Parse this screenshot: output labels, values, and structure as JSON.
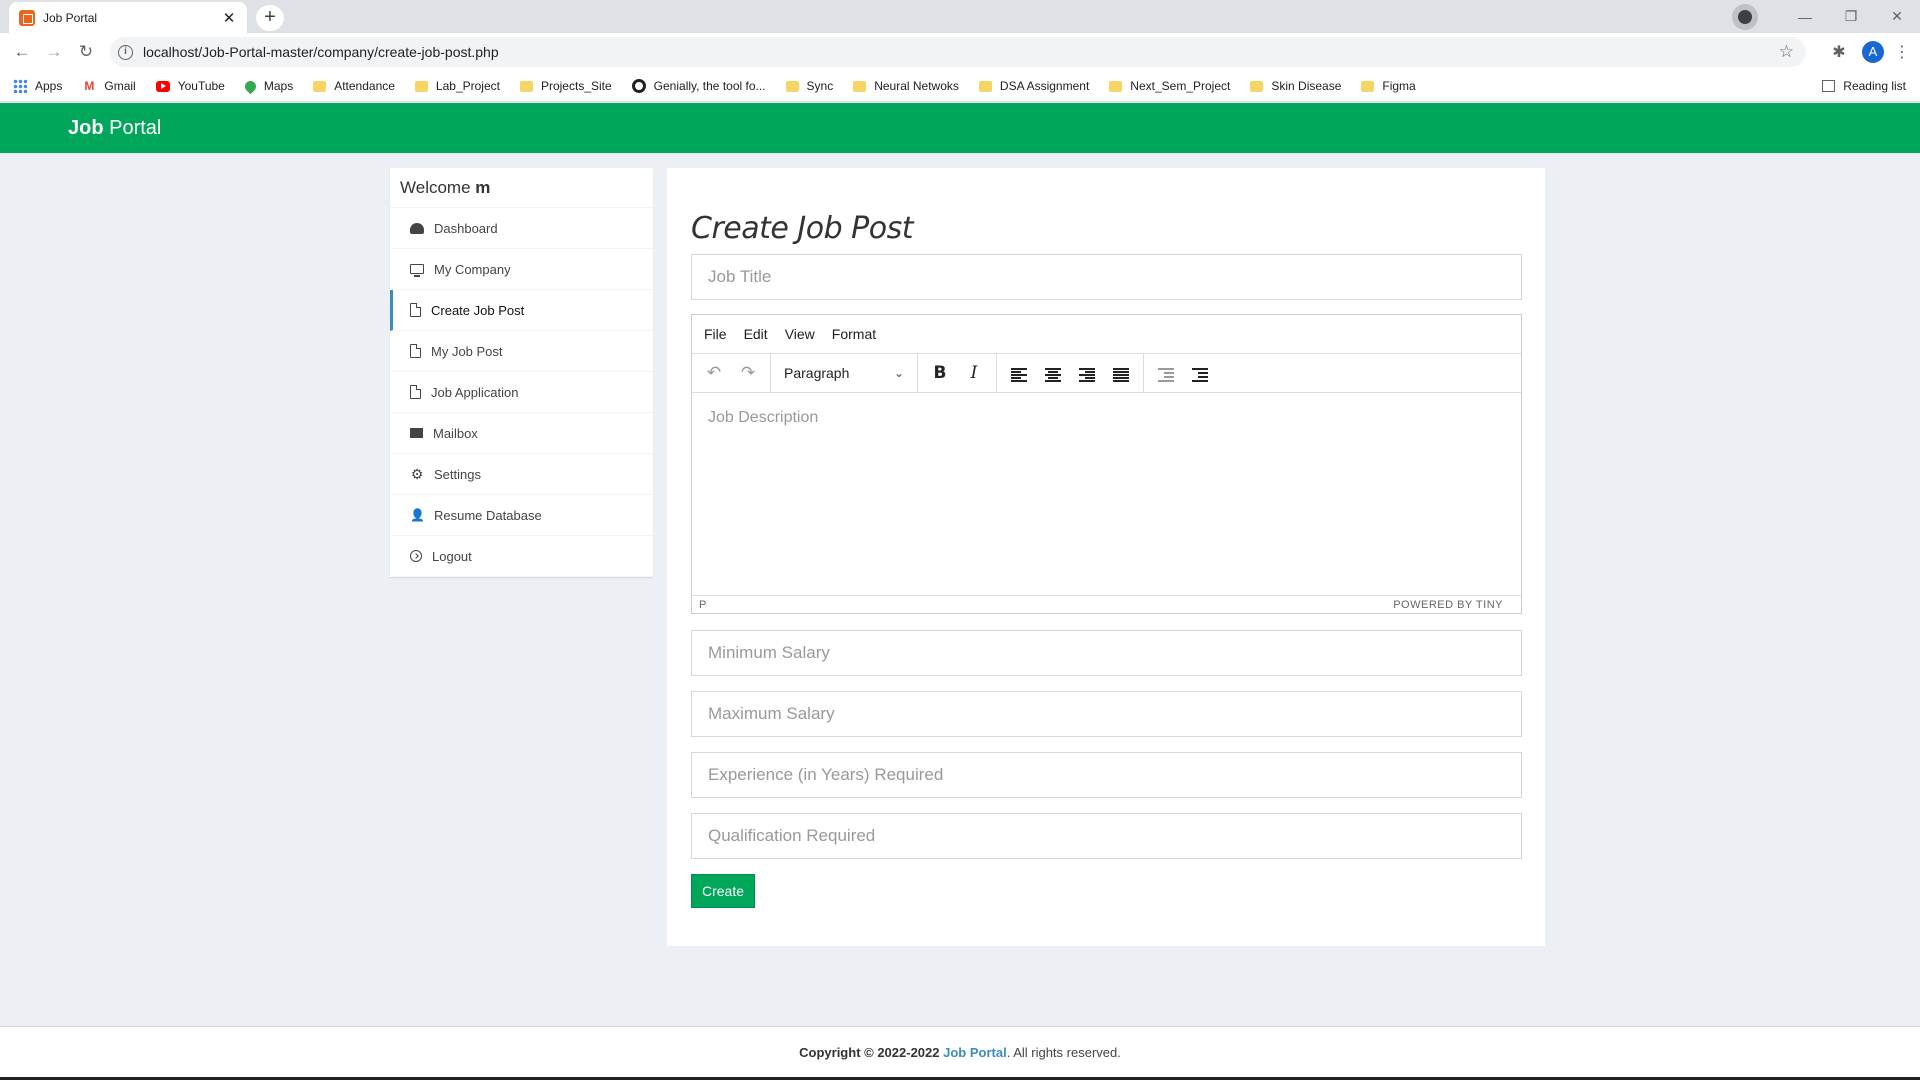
{
  "browser": {
    "tab_title": "Job Portal",
    "url": "localhost/Job-Portal-master/company/create-job-post.php",
    "profile_initial": "A",
    "bookmarks": [
      "Apps",
      "Gmail",
      "YouTube",
      "Maps",
      "Attendance",
      "Lab_Project",
      "Projects_Site",
      "Genially, the tool fo...",
      "Sync",
      "Neural Netwoks",
      "DSA Assignment",
      "Next_Sem_Project",
      "Skin Disease",
      "Figma"
    ],
    "reading_list": "Reading list"
  },
  "header": {
    "logo_bold": "Job",
    "logo_rest": " Portal",
    "color": "#00a65a"
  },
  "sidebar": {
    "welcome_prefix": "Welcome ",
    "welcome_user": "m",
    "items": [
      {
        "label": "Dashboard",
        "icon": "dashboard-icon"
      },
      {
        "label": "My Company",
        "icon": "monitor-icon"
      },
      {
        "label": "Create Job Post",
        "icon": "file-icon",
        "active": true
      },
      {
        "label": "My Job Post",
        "icon": "file-icon"
      },
      {
        "label": "Job Application",
        "icon": "file-icon"
      },
      {
        "label": "Mailbox",
        "icon": "envelope-icon"
      },
      {
        "label": "Settings",
        "icon": "gear-icon"
      },
      {
        "label": "Resume Database",
        "icon": "user-icon"
      },
      {
        "label": "Logout",
        "icon": "logout-icon"
      }
    ]
  },
  "form": {
    "title": "Create Job Post",
    "job_title_placeholder": "Job Title",
    "editor": {
      "menus": [
        "File",
        "Edit",
        "View",
        "Format"
      ],
      "block_format": "Paragraph",
      "placeholder": "Job Description",
      "path": "P",
      "branding": "POWERED BY TINY"
    },
    "min_salary_placeholder": "Minimum Salary",
    "max_salary_placeholder": "Maximum Salary",
    "experience_placeholder": "Experience (in Years) Required",
    "qualification_placeholder": "Qualification Required",
    "submit_label": "Create"
  },
  "footer": {
    "copyright": "Copyright © 2022-2022 ",
    "brand": "Job Portal",
    "suffix": ". All rights reserved."
  }
}
